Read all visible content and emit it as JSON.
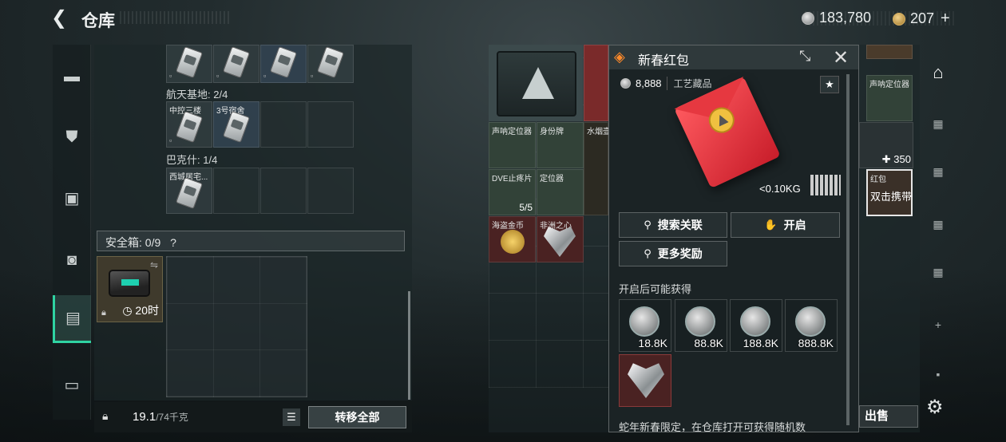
{
  "header": {
    "title": "仓库",
    "silver": "183,780",
    "gold": "207"
  },
  "left_nav": [
    "gun-icon",
    "armor-icon",
    "vest-icon",
    "backpack-icon",
    "case-icon",
    "briefcase-icon"
  ],
  "left_panel": {
    "section1": "航天基地: 2/4",
    "section1_slots": [
      "中控三楼",
      "3号宿舍"
    ],
    "section2": "巴克什: 1/4",
    "section2_slots": [
      "西城居宅..."
    ],
    "safe_label": "安全箱: 0/9",
    "safe_help": "?",
    "safebox_time": "20时",
    "weight": "19.1",
    "weight_max": "/74千克",
    "move_all": "转移全部"
  },
  "storage": {
    "items": [
      {
        "label": "声呐定位器"
      },
      {
        "label": "身份牌"
      },
      {
        "label": "水烟壶"
      },
      {
        "label": "DVE止疼片",
        "count": "5/5"
      },
      {
        "label": "定位器"
      },
      {
        "label": "海盗金币"
      },
      {
        "label": "非洲之心"
      }
    ],
    "right_items": [
      {
        "label": "声呐定位器"
      },
      {
        "label": "红包",
        "hint": "双击携带"
      }
    ],
    "plus_count": "350",
    "sell": "出售"
  },
  "popup": {
    "title": "新春红包",
    "value": "8,888",
    "category": "工艺藏品",
    "weight": "<0.10KG",
    "btn_search": "搜索关联",
    "btn_open": "开启",
    "btn_more": "更多奖励",
    "possible": "开启后可能获得",
    "rewards": [
      "18.8K",
      "88.8K",
      "188.8K",
      "888.8K"
    ],
    "description": "蛇年新春限定，在仓库打开可获得随机数"
  },
  "colors": {
    "accent": "#2fd3a2",
    "popup_icon": "#ff8a2a",
    "envelope": "#e02a36"
  }
}
